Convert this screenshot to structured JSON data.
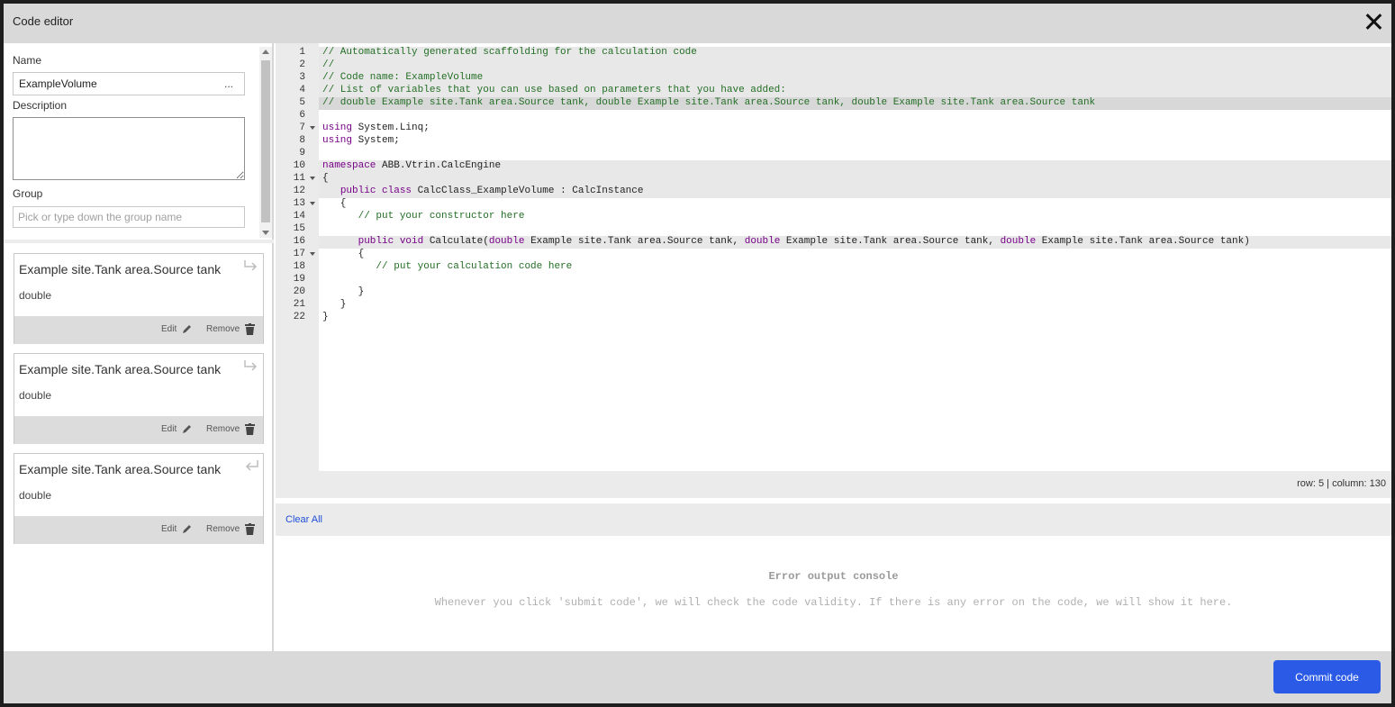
{
  "dialog": {
    "title": "Code editor",
    "close_icon": "close-icon"
  },
  "form": {
    "name_label": "Name",
    "name_value": "ExampleVolume",
    "name_more": "...",
    "description_label": "Description",
    "description_value": "",
    "group_label": "Group",
    "group_placeholder": "Pick or type down the group name"
  },
  "parameters": [
    {
      "name": "Example site.Tank area.Source tank",
      "type": "double",
      "edit_label": "Edit",
      "remove_label": "Remove",
      "direction_icon": "output-arrow-icon"
    },
    {
      "name": "Example site.Tank area.Source tank",
      "type": "double",
      "edit_label": "Edit",
      "remove_label": "Remove",
      "direction_icon": "output-arrow-icon"
    },
    {
      "name": "Example site.Tank area.Source tank",
      "type": "double",
      "edit_label": "Edit",
      "remove_label": "Remove",
      "direction_icon": "input-arrow-icon"
    }
  ],
  "code": {
    "lines": [
      "// Automatically generated scaffolding for the calculation code",
      "//",
      "// Code name: ExampleVolume",
      "// List of variables that you can use based on parameters that you have added:",
      "// double Example site.Tank area.Source tank, double Example site.Tank area.Source tank, double Example site.Tank area.Source tank",
      "",
      "using System.Linq;",
      "using System;",
      "",
      "namespace ABB.Vtrin.CalcEngine",
      "{",
      "   public class CalcClass_ExampleVolume : CalcInstance",
      "   {",
      "      // put your constructor here",
      "",
      "      public void Calculate(double Example site.Tank area.Source tank, double Example site.Tank area.Source tank, double Example site.Tank area.Source tank)",
      "      {",
      "         // put your calculation code here",
      "",
      "      }",
      "   }",
      "}"
    ],
    "fold_lines": [
      7,
      11,
      13,
      17
    ],
    "cursor_row": 5,
    "cursor_column": 130
  },
  "status": {
    "text": "row: 5 | column: 130"
  },
  "console": {
    "clear_all": "Clear All",
    "title": "Error output console",
    "message": "Whenever you click 'submit code', we will check the code validity. If there is any error on the code, we will show it here."
  },
  "footer": {
    "commit_label": "Commit code"
  },
  "colors": {
    "accent": "#2b5be6",
    "comment": "#236e25",
    "keyword": "#770088",
    "link": "#1f4ed8"
  }
}
